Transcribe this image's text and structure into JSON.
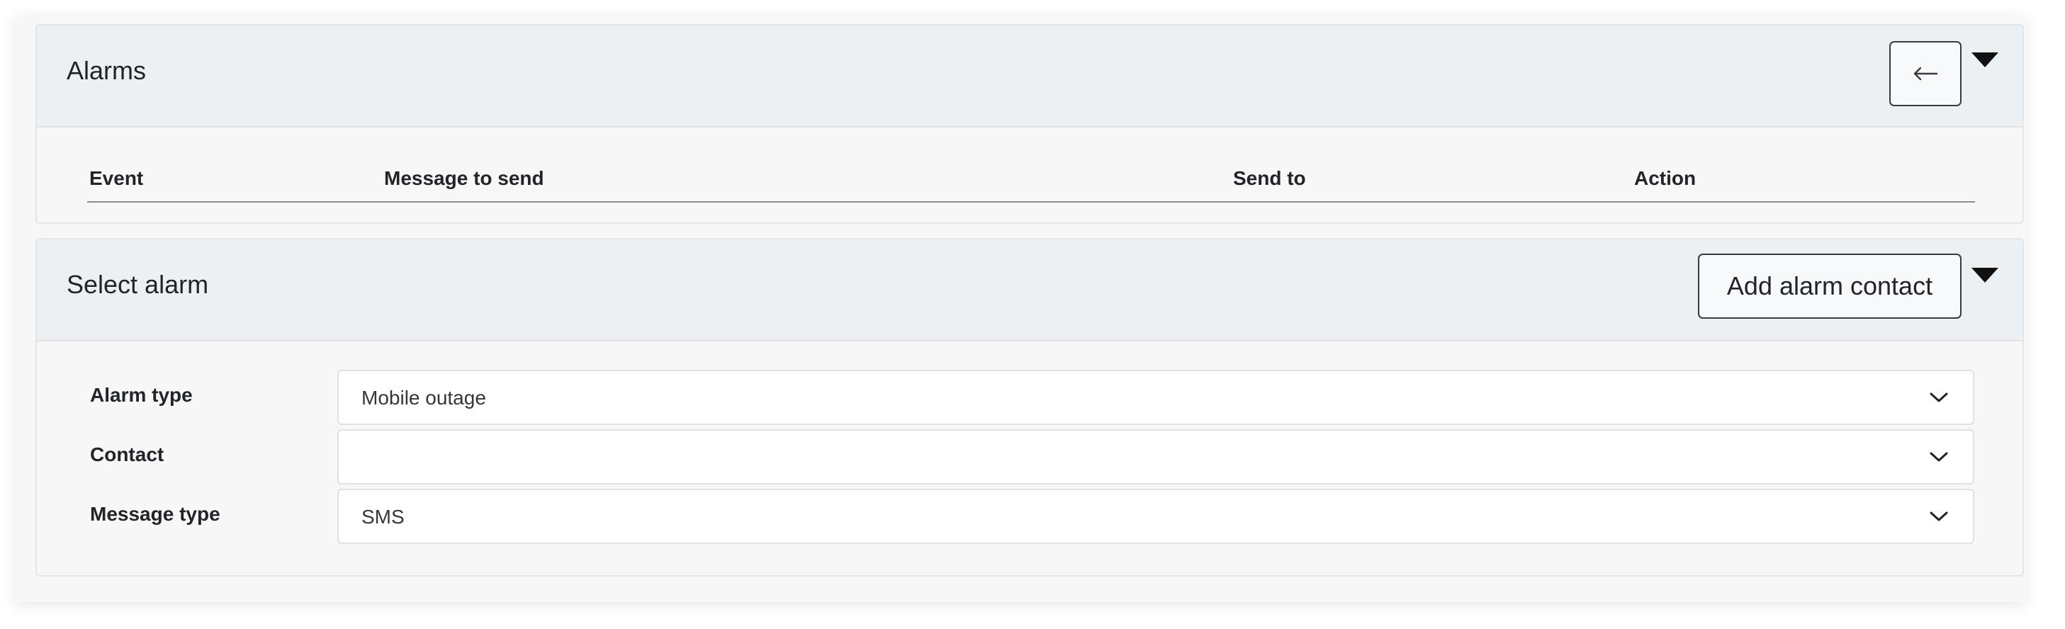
{
  "alarms_panel": {
    "title": "Alarms",
    "back_icon": "arrow-left-icon",
    "collapse_icon": "caret-down-icon",
    "table": {
      "columns": [
        "Event",
        "Message to send",
        "Send to",
        "Action"
      ],
      "rows": []
    }
  },
  "select_alarm_panel": {
    "title": "Select alarm",
    "add_button_label": "Add alarm contact",
    "collapse_icon": "caret-down-icon",
    "fields": [
      {
        "label": "Alarm type",
        "value": "Mobile outage",
        "icon": "chevron-down-icon"
      },
      {
        "label": "Contact",
        "value": "",
        "icon": "chevron-down-icon"
      },
      {
        "label": "Message type",
        "value": "SMS",
        "icon": "chevron-down-icon"
      }
    ]
  }
}
